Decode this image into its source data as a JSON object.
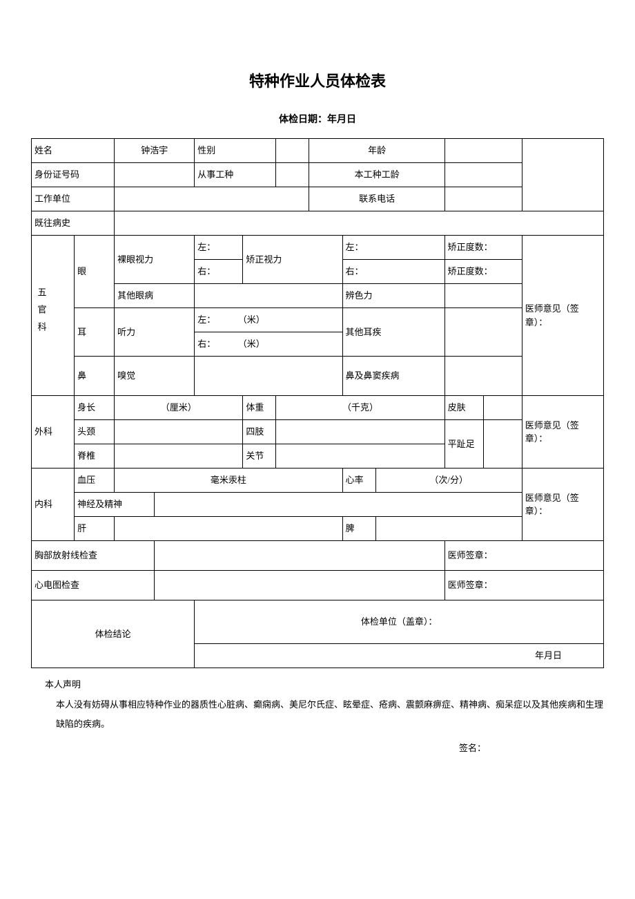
{
  "title": "特种作业人员体检表",
  "exam_date_label": "体检日期：年月日",
  "basic": {
    "name_label": "姓名",
    "name_value": "钟浩宇",
    "gender_label": "性别",
    "gender_value": "",
    "age_label": "年龄",
    "age_value": "",
    "id_label": "身份证号码",
    "id_value": "",
    "work_type_label": "从事工种",
    "work_type_value": "",
    "work_age_label": "本工种工龄",
    "work_age_value": "",
    "work_unit_label": "工作单位",
    "work_unit_value": "",
    "phone_label": "联系电话",
    "phone_value": "",
    "history_label": "既往病史",
    "history_value": ""
  },
  "wuguan": {
    "section_label": "五官科",
    "eye_label": "眼",
    "naked_vision_label": "裸眼视力",
    "left_label": "左：",
    "right_label": "右：",
    "corrected_vision_label": "矫正视力",
    "corrected_degree_label": "矫正度数：",
    "other_eye_label": "其他眼病",
    "other_eye_value": "",
    "color_sense_label": "辨色力",
    "color_sense_value": "",
    "ear_label": "耳",
    "hearing_label": "听力",
    "hearing_left": "左：          （米）",
    "hearing_right": "右：          （米）",
    "other_ear_label": "其他耳疾",
    "other_ear_value": "",
    "nose_label": "鼻",
    "smell_label": "嗅觉",
    "smell_value": "",
    "nose_disease_label": "鼻及鼻窦疾病",
    "nose_disease_value": ""
  },
  "surgery": {
    "section_label": "外科",
    "height_label": "身长",
    "height_unit": "（厘米）",
    "weight_label": "体重",
    "weight_unit": "（千克）",
    "skin_label": "皮肤",
    "skin_value": "",
    "head_neck_label": "头颈",
    "head_neck_value": "",
    "limbs_label": "四肢",
    "limbs_value": "",
    "flat_foot_label": "平趾足",
    "flat_foot_value": "",
    "spine_label": "脊椎",
    "spine_value": "",
    "joint_label": "关节",
    "joint_value": ""
  },
  "internal": {
    "section_label": "内科",
    "bp_label": "血压",
    "bp_unit": "毫米汞柱",
    "hr_label": "心率",
    "hr_unit": "（次/分）",
    "nerve_label": "神经及精神",
    "nerve_value": "",
    "liver_label": "肝",
    "liver_value": "",
    "spleen_label": "脾",
    "spleen_value": ""
  },
  "xray": {
    "label": "胸部放射线检查",
    "value": "",
    "sign_label": "医师签章："
  },
  "ecg": {
    "label": "心电图检查",
    "value": "",
    "sign_label": "医师签章："
  },
  "doctor_opinion_label": "医师意见（签章）：",
  "conclusion": {
    "label": "体检结论",
    "unit_stamp": "体检单位（盖章）：",
    "date": "年月日"
  },
  "declaration": {
    "head": "本人声明",
    "body": "本人没有妨碍从事相应特种作业的器质性心脏病、癫痫病、美尼尔氏症、眩晕症、疮病、震颤麻痹症、精神病、痴呆症以及其他疾病和生理缺陷的疾病。",
    "sign": "签名："
  }
}
